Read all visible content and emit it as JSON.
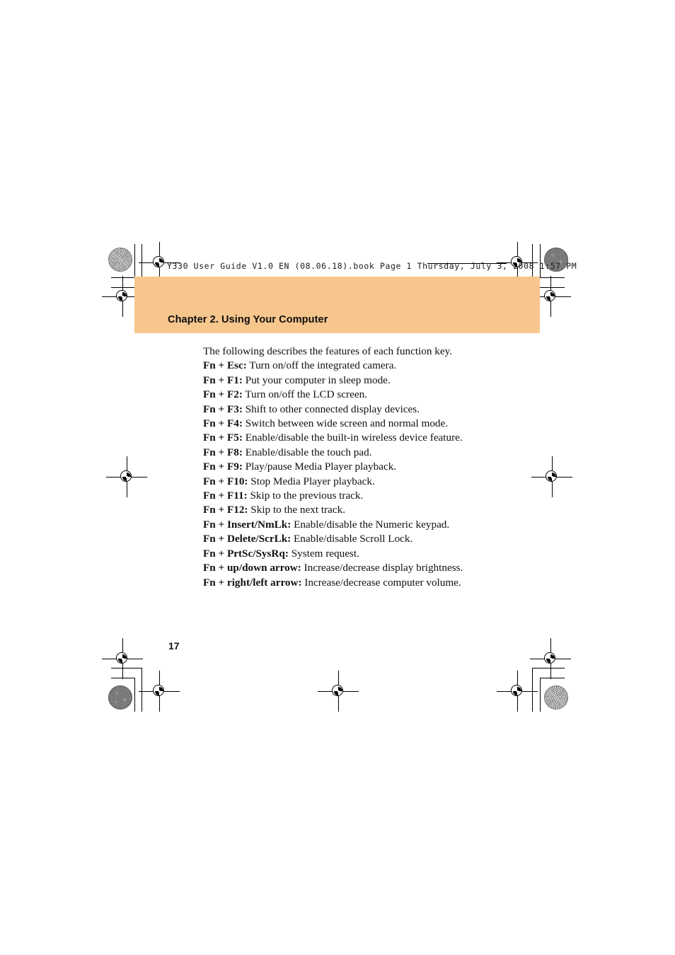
{
  "document": {
    "header_line": "Y330 User Guide V1.0 EN (08.06.18).book  Page 1  Thursday, July 3, 2008  1:57 PM",
    "chapter_title": "Chapter 2. Using Your Computer",
    "page_number": "17",
    "band_color": "#f6c68d"
  },
  "body": {
    "intro": "The following describes the features of each function key.",
    "shortcuts": [
      {
        "key": "Fn + Esc:",
        "desc": " Turn on/off the integrated camera."
      },
      {
        "key": "Fn + F1:",
        "desc": " Put your computer in sleep mode."
      },
      {
        "key": "Fn + F2:",
        "desc": " Turn on/off the LCD screen."
      },
      {
        "key": "Fn + F3:",
        "desc": " Shift to other connected display devices."
      },
      {
        "key": "Fn + F4:",
        "desc": " Switch between wide screen and normal mode."
      },
      {
        "key": "Fn + F5:",
        "desc": " Enable/disable the built-in wireless device feature."
      },
      {
        "key": "Fn + F8:",
        "desc": " Enable/disable the touch pad."
      },
      {
        "key": "Fn + F9:",
        "desc": " Play/pause Media Player playback."
      },
      {
        "key": "Fn + F10:",
        "desc": " Stop Media Player playback."
      },
      {
        "key": "Fn + F11:",
        "desc": " Skip to the previous track."
      },
      {
        "key": "Fn + F12:",
        "desc": " Skip to the next track."
      },
      {
        "key": "Fn + Insert/NmLk:",
        "desc": " Enable/disable the Numeric keypad."
      },
      {
        "key": "Fn + Delete/ScrLk:",
        "desc": " Enable/disable Scroll Lock."
      },
      {
        "key": "Fn + PrtSc/SysRq:",
        "desc": " System request."
      },
      {
        "key": "Fn + up/down arrow:",
        "desc": " Increase/decrease display brightness."
      },
      {
        "key": "Fn + right/left arrow:",
        "desc": " Increase/decrease computer volume."
      }
    ]
  }
}
